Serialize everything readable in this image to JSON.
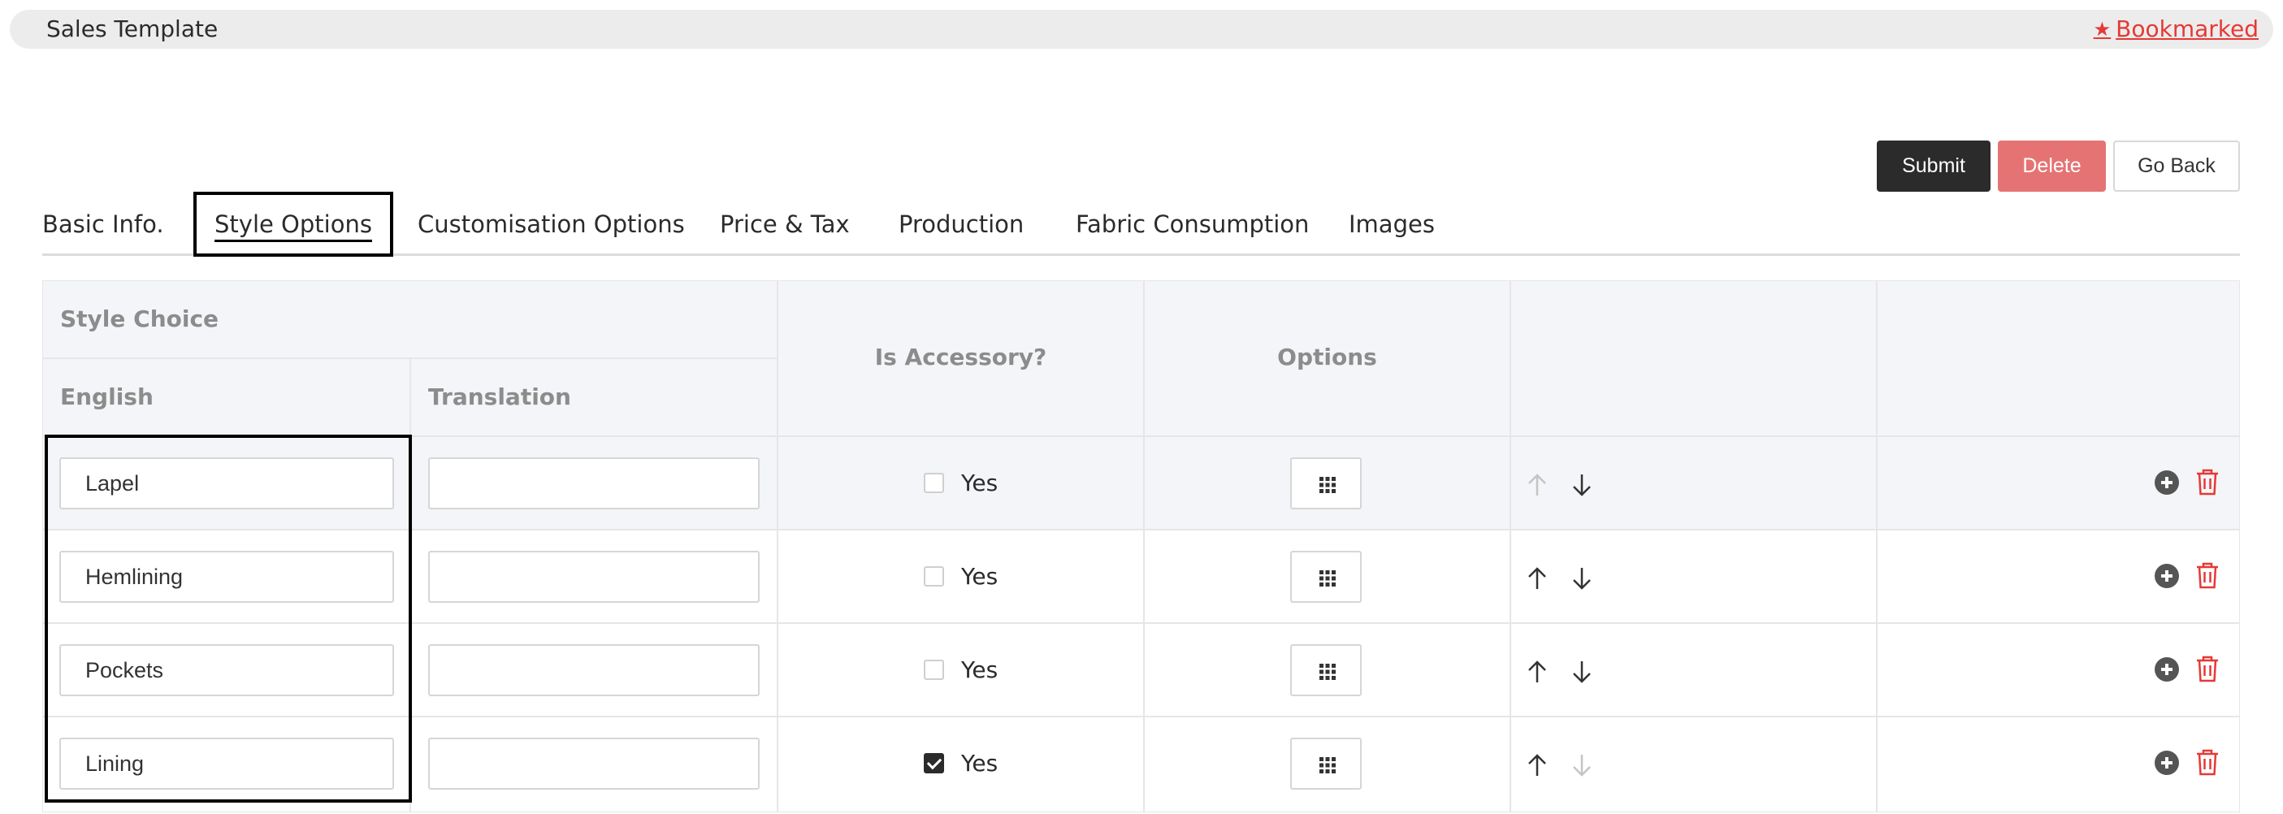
{
  "header": {
    "title": "Sales Template",
    "bookmark_label": "Bookmarked",
    "bookmark_icon": "star-icon",
    "accent": "#e53935"
  },
  "actions": {
    "submit": "Submit",
    "delete": "Delete",
    "back": "Go Back"
  },
  "tabs": [
    {
      "label": "Basic Info.",
      "active": false
    },
    {
      "label": "Style Options",
      "active": true
    },
    {
      "label": "Customisation Options",
      "active": false
    },
    {
      "label": "Price & Tax",
      "active": false
    },
    {
      "label": "Production",
      "active": false
    },
    {
      "label": "Fabric Consumption",
      "active": false
    },
    {
      "label": "Images",
      "active": false
    }
  ],
  "table": {
    "group_header": "Style Choice",
    "col_english": "English",
    "col_translation": "Translation",
    "col_accessory": "Is Accessory?",
    "col_options": "Options",
    "yes_label": "Yes",
    "rows": [
      {
        "english": "Lapel",
        "translation": "",
        "accessory": false,
        "up_enabled": false,
        "down_enabled": true
      },
      {
        "english": "Hemlining",
        "translation": "",
        "accessory": false,
        "up_enabled": true,
        "down_enabled": true
      },
      {
        "english": "Pockets",
        "translation": "",
        "accessory": false,
        "up_enabled": true,
        "down_enabled": true
      },
      {
        "english": "Lining",
        "translation": "",
        "accessory": true,
        "up_enabled": true,
        "down_enabled": false
      }
    ]
  }
}
